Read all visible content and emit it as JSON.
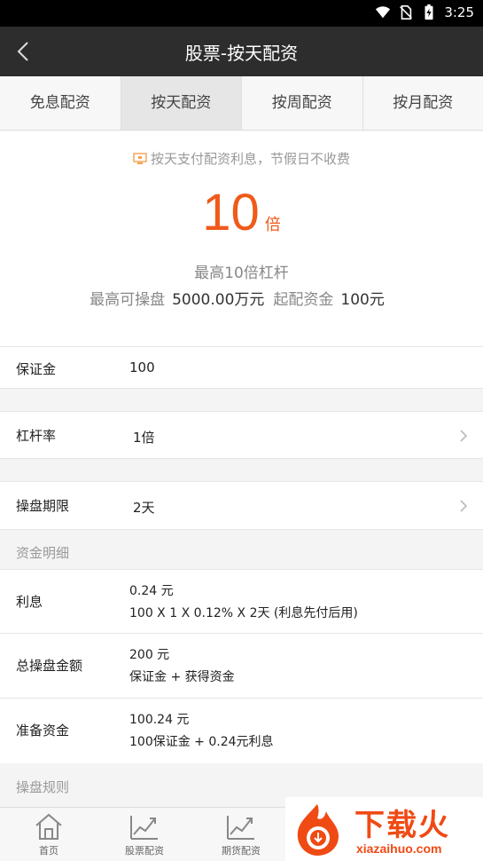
{
  "status_bar": {
    "time": "3:25"
  },
  "nav": {
    "title": "股票-按天配资"
  },
  "tabs": [
    {
      "label": "免息配资"
    },
    {
      "label": "按天配资"
    },
    {
      "label": "按周配资"
    },
    {
      "label": "按月配资"
    }
  ],
  "hero": {
    "tip": "按天支付配资利息，节假日不收费",
    "multiplier": "10",
    "multiplier_unit": "倍",
    "max_leverage": "最高10倍杠杆",
    "max_trade_label": "最高可操盘",
    "max_trade_value": "5000.00万元",
    "min_fund_label": "起配资金",
    "min_fund_value": "100元"
  },
  "form": {
    "deposit": {
      "label": "保证金",
      "value": "100"
    },
    "leverage": {
      "label": "杠杆率",
      "value": "1倍"
    },
    "period": {
      "label": "操盘期限",
      "value": "2天"
    }
  },
  "fund_detail": {
    "title": "资金明细",
    "interest": {
      "label": "利息",
      "line1": "0.24 元",
      "line2": "100 X 1 X 0.12% X 2天 (利息先付后用)"
    },
    "total": {
      "label": "总操盘金额",
      "line1": "200 元",
      "line2": "保证金 + 获得资金"
    },
    "prepare": {
      "label": "准备资金",
      "line1": "100.24 元",
      "line2": "100保证金 + 0.24元利息"
    }
  },
  "rules": {
    "title": "操盘规则"
  },
  "bottom_nav": [
    {
      "label": "首页"
    },
    {
      "label": "股票配资"
    },
    {
      "label": "期货配资"
    }
  ],
  "watermark": {
    "text": "下载火",
    "url": "xiazaihuo.com"
  },
  "colors": {
    "accent": "#f05a1a",
    "navbar": "#2d2d2d"
  }
}
